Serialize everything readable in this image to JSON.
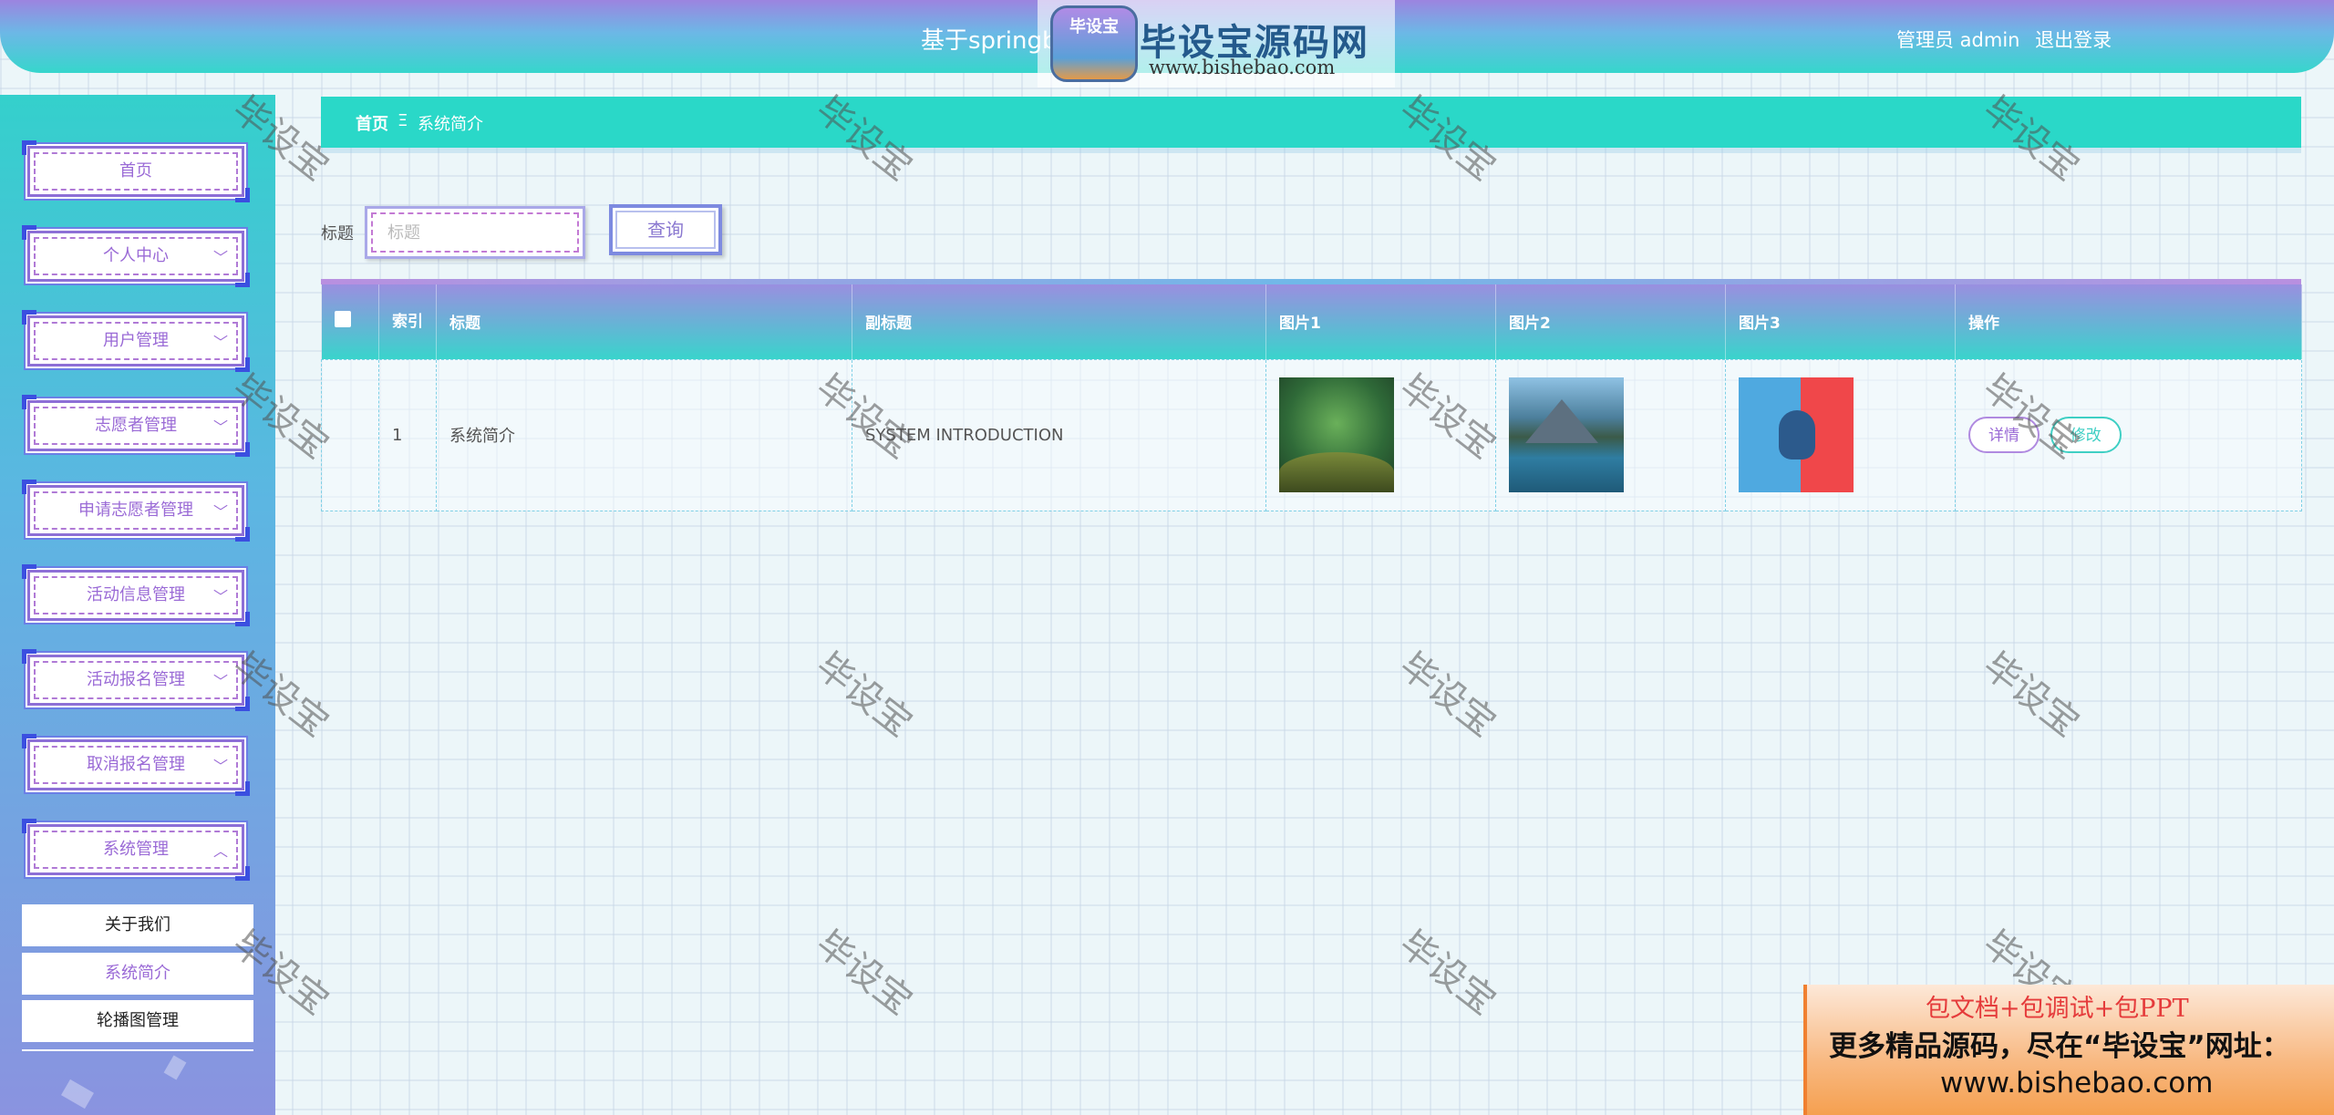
{
  "header": {
    "title": "基于springboot",
    "user_label": "管理员 admin",
    "logout": "退出登录"
  },
  "logo": {
    "badge_text": "毕设宝",
    "name": "毕设宝源码网",
    "url": "www.bishebao.com"
  },
  "sidebar": {
    "items": [
      {
        "label": "首页",
        "chevron": ""
      },
      {
        "label": "个人中心",
        "chevron": "﹀"
      },
      {
        "label": "用户管理",
        "chevron": "﹀"
      },
      {
        "label": "志愿者管理",
        "chevron": "﹀"
      },
      {
        "label": "申请志愿者管理",
        "chevron": "﹀"
      },
      {
        "label": "活动信息管理",
        "chevron": "﹀"
      },
      {
        "label": "活动报名管理",
        "chevron": "﹀"
      },
      {
        "label": "取消报名管理",
        "chevron": "﹀"
      },
      {
        "label": "系统管理",
        "chevron": "︿"
      }
    ],
    "submenu": [
      "关于我们",
      "系统简介",
      "轮播图管理"
    ]
  },
  "breadcrumb": {
    "home": "首页",
    "separator": "Ξ",
    "current": "系统简介"
  },
  "search": {
    "label": "标题",
    "placeholder": "标题",
    "value": "",
    "button": "查询"
  },
  "table": {
    "columns": [
      "索引",
      "标题",
      "副标题",
      "图片1",
      "图片2",
      "图片3",
      "操作"
    ],
    "rows": [
      {
        "index": "1",
        "title": "系统简介",
        "subtitle": "SYSTEM INTRODUCTION",
        "image1": "green-moss-photo",
        "image2": "mountain-lake-photo",
        "image3": "gamepad-illustration",
        "actions": [
          "详情",
          "修改"
        ]
      }
    ]
  },
  "watermark": "毕设宝",
  "promo": {
    "line1": "包文档+包调试+包PPT",
    "line2": "更多精品源码，尽在“毕设宝”网址：",
    "line3": "www.bishebao.com"
  },
  "colors": {
    "accent_teal": "#2ad8c8",
    "accent_purple": "#9a6ad6",
    "sidebar_blue": "#3b4fe0"
  }
}
